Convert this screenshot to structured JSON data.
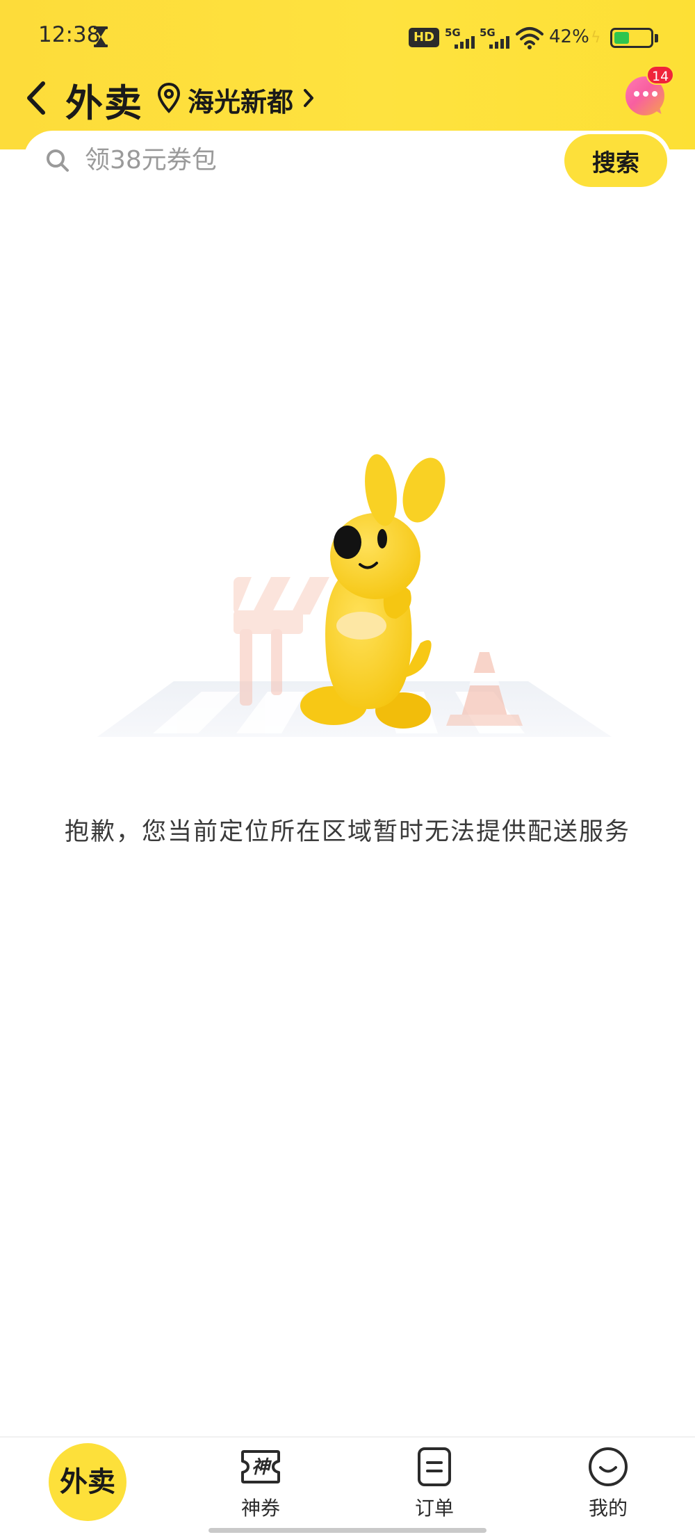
{
  "status_bar": {
    "time": "12:38",
    "network_badge": "HD",
    "signal_1_label": "5G",
    "signal_2_label": "5G",
    "battery_percent": "42%",
    "battery_level": 0.42,
    "icons": [
      "hourglass-icon",
      "hd-icon",
      "signal-icon",
      "wifi-icon",
      "charging-icon",
      "battery-icon"
    ]
  },
  "header": {
    "title": "外卖",
    "location": "海光新都",
    "message_badge_count": "14",
    "accent_color": "#fee23f"
  },
  "search": {
    "placeholder": "领38元券包",
    "button_label": "搜索"
  },
  "empty_state": {
    "message": "抱歉，您当前定位所在区域暂时无法提供配送服务"
  },
  "tabs": [
    {
      "label": "外卖",
      "icon": "takeout-home-icon",
      "active": true
    },
    {
      "label": "神券",
      "icon": "coupon-icon"
    },
    {
      "label": "订单",
      "icon": "order-list-icon"
    },
    {
      "label": "我的",
      "icon": "profile-smile-icon"
    }
  ],
  "coupon_icon_glyph": "神"
}
